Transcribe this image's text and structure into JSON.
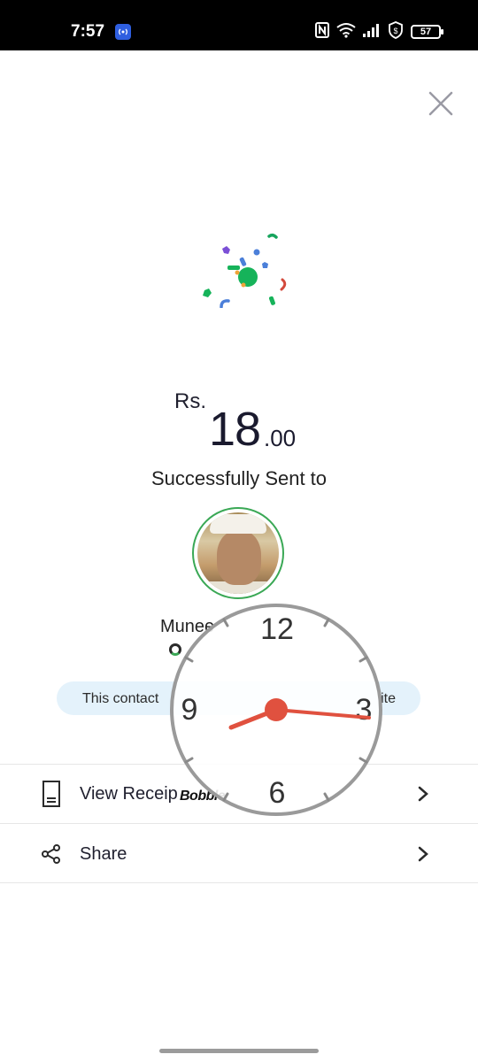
{
  "status_bar": {
    "time": "7:57",
    "battery": "57",
    "icons": [
      "hotspot-icon",
      "nfc-icon",
      "wifi-icon",
      "signal-icon",
      "vpn-icon",
      "battery-icon"
    ]
  },
  "header": {
    "close_icon": "close-icon"
  },
  "payment": {
    "currency": "Rs.",
    "amount_integer": "18",
    "amount_decimal": ".00",
    "status_text": "Successfully Sent to",
    "recipient_name": "Munee",
    "notice_left": "This contact",
    "notice_right": "ite"
  },
  "actions": [
    {
      "label": "View Receip",
      "icon": "receipt-icon"
    },
    {
      "label": "Share",
      "icon": "share-icon"
    }
  ],
  "overlay": {
    "bobble_text": "Bobble",
    "clock_numbers": [
      "12",
      "3",
      "6",
      "9"
    ]
  },
  "colors": {
    "accent_green": "#3aa855",
    "pill_background": "#e4f2fb",
    "clock_hands": "#e0513f"
  }
}
